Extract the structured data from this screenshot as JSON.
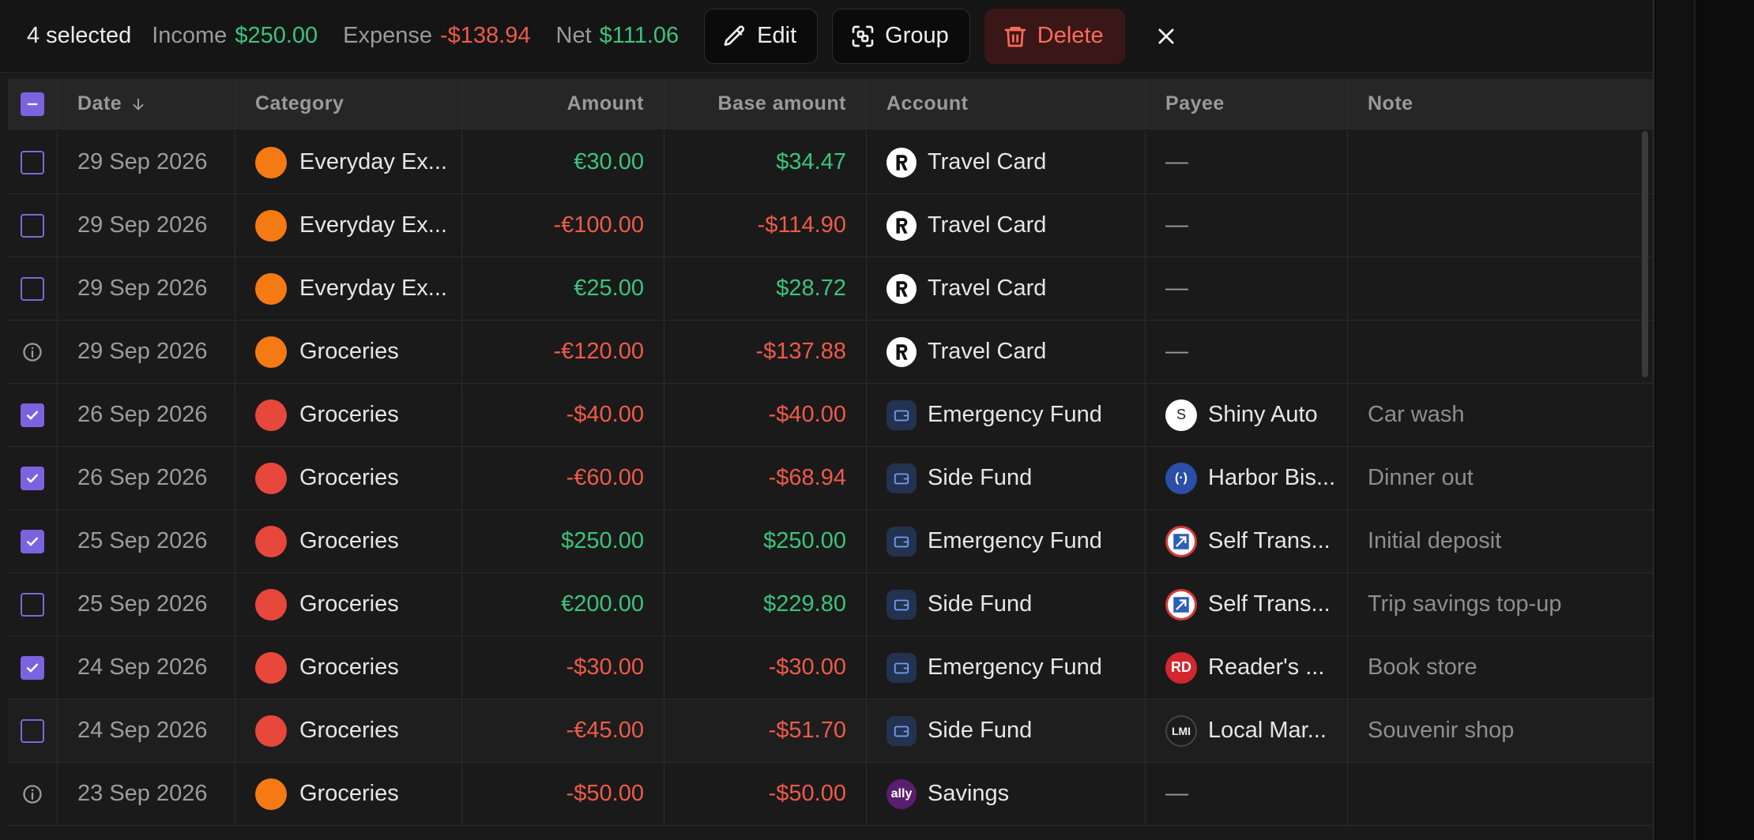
{
  "toolbar": {
    "selected": "4 selected",
    "income_label": "Income",
    "income_value": "$250.00",
    "expense_label": "Expense",
    "expense_value": "-$138.94",
    "net_label": "Net",
    "net_value": "$111.06",
    "edit_label": "Edit",
    "group_label": "Group",
    "delete_label": "Delete"
  },
  "columns": {
    "date": "Date",
    "category": "Category",
    "amount": "Amount",
    "base_amount": "Base amount",
    "account": "Account",
    "payee": "Payee",
    "note": "Note"
  },
  "colors": {
    "accent": "#7b63e0",
    "positive": "#3cc47c",
    "negative": "#ef5a4a",
    "orange": "#f57a14",
    "red": "#e8473c"
  },
  "rows": [
    {
      "state": "unchecked",
      "date": "29 Sep 2026",
      "category": "Everyday Ex...",
      "cat_color": "orange",
      "amount": "€30.00",
      "amount_sign": "pos",
      "base": "$34.47",
      "base_sign": "pos",
      "account": "Travel Card",
      "account_icon": "revolut-icon",
      "payee": "—",
      "payee_icon": "",
      "note": ""
    },
    {
      "state": "unchecked",
      "date": "29 Sep 2026",
      "category": "Everyday Ex...",
      "cat_color": "orange",
      "amount": "-€100.00",
      "amount_sign": "neg",
      "base": "-$114.90",
      "base_sign": "neg",
      "account": "Travel Card",
      "account_icon": "revolut-icon",
      "payee": "—",
      "payee_icon": "",
      "note": ""
    },
    {
      "state": "unchecked",
      "date": "29 Sep 2026",
      "category": "Everyday Ex...",
      "cat_color": "orange",
      "amount": "€25.00",
      "amount_sign": "pos",
      "base": "$28.72",
      "base_sign": "pos",
      "account": "Travel Card",
      "account_icon": "revolut-icon",
      "payee": "—",
      "payee_icon": "",
      "note": ""
    },
    {
      "state": "info",
      "date": "29 Sep 2026",
      "category": "Groceries",
      "cat_color": "orange",
      "amount": "-€120.00",
      "amount_sign": "neg",
      "base": "-$137.88",
      "base_sign": "neg",
      "account": "Travel Card",
      "account_icon": "revolut-icon",
      "payee": "—",
      "payee_icon": "",
      "note": ""
    },
    {
      "state": "checked",
      "date": "26 Sep 2026",
      "category": "Groceries",
      "cat_color": "red",
      "amount": "-$40.00",
      "amount_sign": "neg",
      "base": "-$40.00",
      "base_sign": "neg",
      "account": "Emergency Fund",
      "account_icon": "wallet-icon",
      "payee": "Shiny Auto",
      "payee_icon": "letter",
      "payee_letter": "S",
      "note": "Car wash"
    },
    {
      "state": "checked",
      "date": "26 Sep 2026",
      "category": "Groceries",
      "cat_color": "red",
      "amount": "-€60.00",
      "amount_sign": "neg",
      "base": "-$68.94",
      "base_sign": "neg",
      "account": "Side Fund",
      "account_icon": "wallet-icon",
      "payee": "Harbor Bis...",
      "payee_icon": "harbor",
      "payee_letter": "(·)",
      "note": "Dinner out"
    },
    {
      "state": "checked",
      "date": "25 Sep 2026",
      "category": "Groceries",
      "cat_color": "red",
      "amount": "$250.00",
      "amount_sign": "pos",
      "base": "$250.00",
      "base_sign": "pos",
      "account": "Emergency Fund",
      "account_icon": "wallet-icon",
      "payee": "Self Trans...",
      "payee_icon": "self",
      "payee_letter": "",
      "note": "Initial deposit"
    },
    {
      "state": "unchecked",
      "date": "25 Sep 2026",
      "category": "Groceries",
      "cat_color": "red",
      "amount": "€200.00",
      "amount_sign": "pos",
      "base": "$229.80",
      "base_sign": "pos",
      "account": "Side Fund",
      "account_icon": "wallet-icon",
      "payee": "Self Trans...",
      "payee_icon": "self",
      "payee_letter": "",
      "note": "Trip savings top-up"
    },
    {
      "state": "checked",
      "date": "24 Sep 2026",
      "category": "Groceries",
      "cat_color": "red",
      "amount": "-$30.00",
      "amount_sign": "neg",
      "base": "-$30.00",
      "base_sign": "neg",
      "account": "Emergency Fund",
      "account_icon": "wallet-icon",
      "payee": "Reader's ...",
      "payee_icon": "reader",
      "payee_letter": "RD",
      "note": "Book store"
    },
    {
      "state": "unchecked",
      "date": "24 Sep 2026",
      "category": "Groceries",
      "cat_color": "red",
      "amount": "-€45.00",
      "amount_sign": "neg",
      "base": "-$51.70",
      "base_sign": "neg",
      "account": "Side Fund",
      "account_icon": "wallet-icon",
      "payee": "Local Mar...",
      "payee_icon": "local",
      "payee_letter": "LMI",
      "note": "Souvenir shop"
    },
    {
      "state": "info",
      "date": "23 Sep 2026",
      "category": "Groceries",
      "cat_color": "orange",
      "amount": "-$50.00",
      "amount_sign": "neg",
      "base": "-$50.00",
      "base_sign": "neg",
      "account": "Savings",
      "account_icon": "ally-icon",
      "account_letter": "ally",
      "payee": "—",
      "payee_icon": "",
      "note": ""
    }
  ]
}
